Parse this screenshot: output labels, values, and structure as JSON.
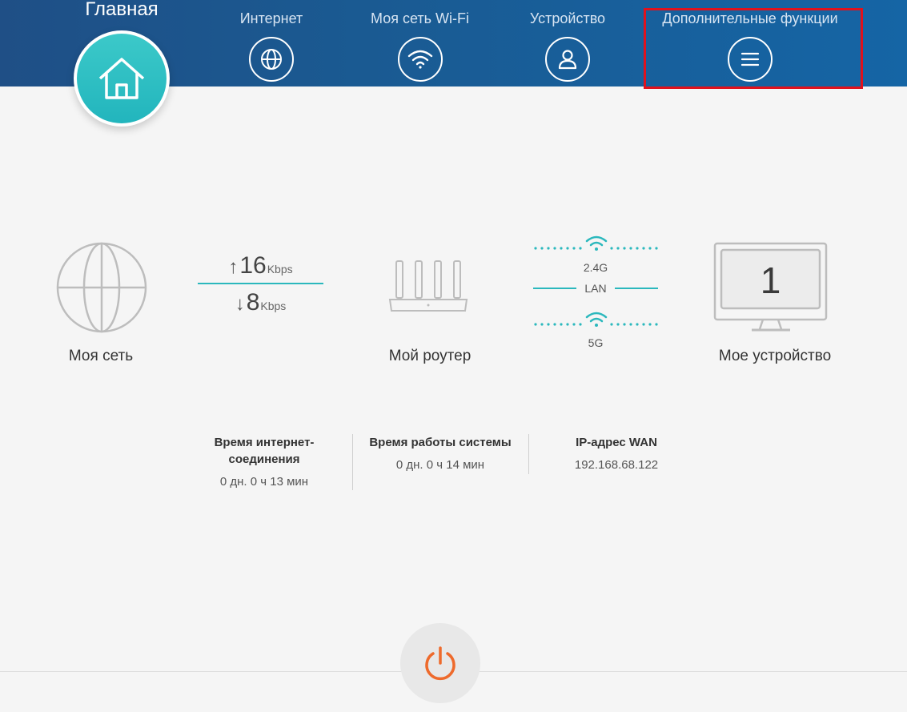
{
  "header": {
    "home_title": "Главная",
    "nav": [
      {
        "label": "Интернет",
        "icon": "globe-icon"
      },
      {
        "label": "Моя сеть Wi-Fi",
        "icon": "wifi-icon"
      },
      {
        "label": "Устройство",
        "icon": "user-icon"
      },
      {
        "label": "Дополнительные функции",
        "icon": "menu-icon"
      }
    ],
    "colors": {
      "bar": "#1a5a92",
      "accent": "#2bb8bd",
      "highlight": "#e0121d"
    }
  },
  "topology": {
    "my_network_label": "Моя сеть",
    "upload": {
      "value": "16",
      "unit": "Kbps"
    },
    "download": {
      "value": "8",
      "unit": "Kbps"
    },
    "router_label": "Мой роутер",
    "band_24": "2.4G",
    "lan": "LAN",
    "band_5": "5G",
    "device_count": "1",
    "device_label": "Мое устройство"
  },
  "info": {
    "conn_time_title": "Время интернет-соединения",
    "conn_time_value": "0 дн. 0 ч 13 мин",
    "uptime_title": "Время работы системы",
    "uptime_value": "0 дн. 0 ч 14 мин",
    "wan_ip_title": "IP-адрес WAN",
    "wan_ip_value": "192.168.68.122"
  },
  "power": {
    "icon": "power-icon",
    "color": "#ee6a2c"
  }
}
